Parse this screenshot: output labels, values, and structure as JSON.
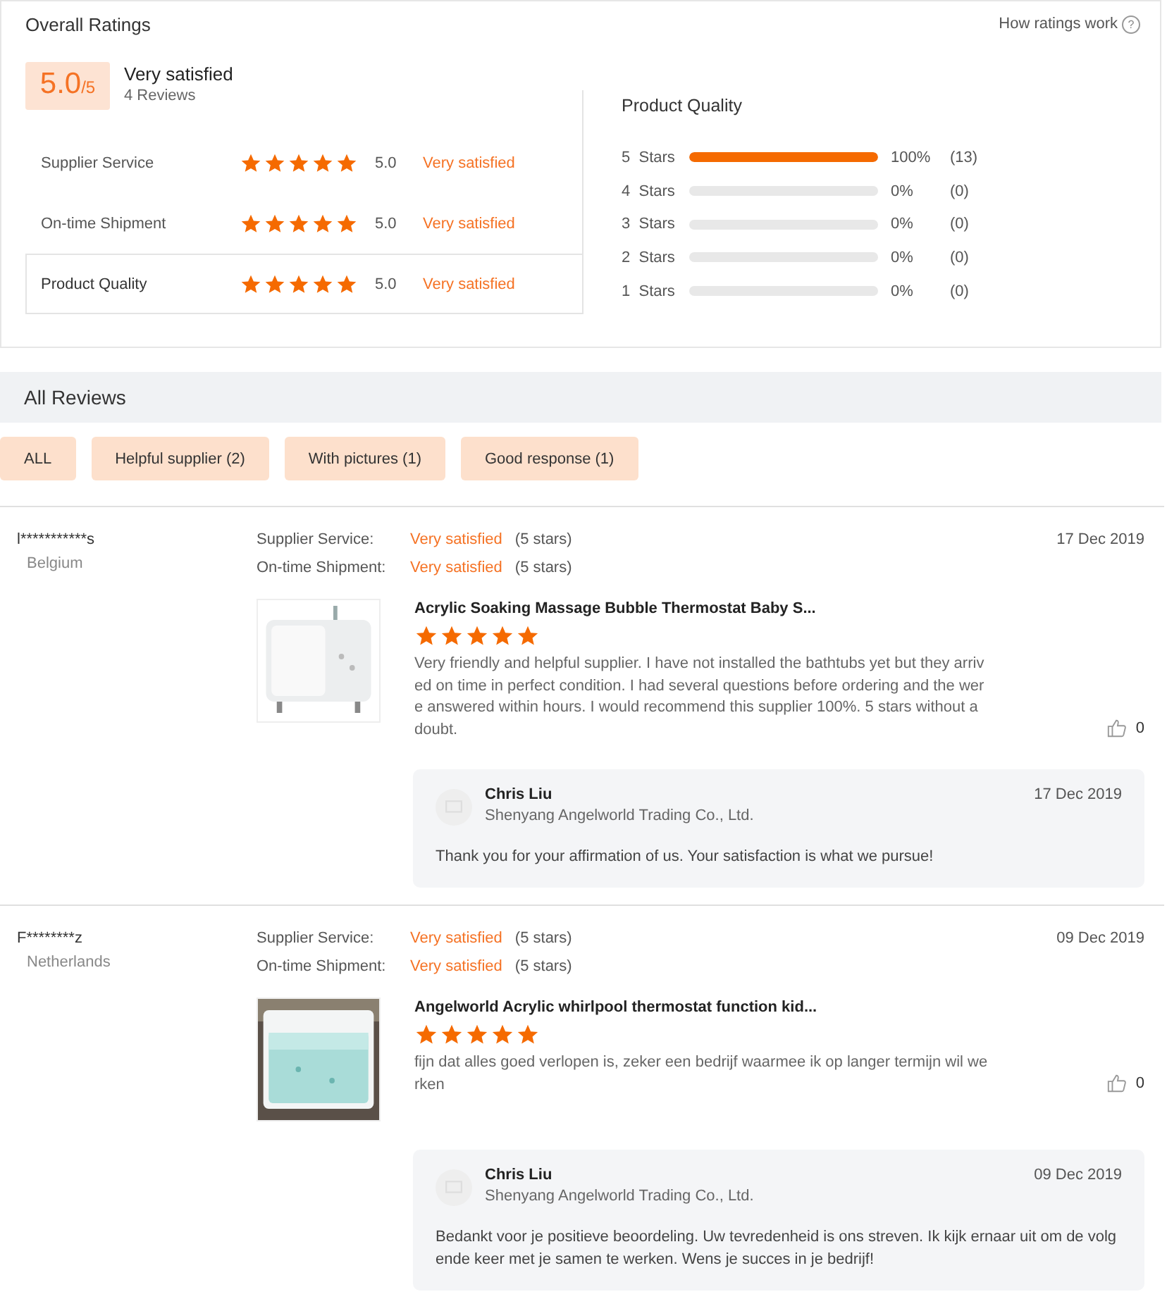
{
  "overall": {
    "title": "Overall Ratings",
    "help_link": "How ratings work",
    "help_icon": "?",
    "score": "5.0",
    "score_max": "/5",
    "verdict": "Very satisfied",
    "review_count": "4 Reviews",
    "categories": [
      {
        "name": "Supplier Service",
        "stars": 5,
        "score": "5.0",
        "verdict": "Very satisfied",
        "selected": false
      },
      {
        "name": "On-time Shipment",
        "stars": 5,
        "score": "5.0",
        "verdict": "Very satisfied",
        "selected": false
      },
      {
        "name": "Product Quality",
        "stars": 5,
        "score": "5.0",
        "verdict": "Very satisfied",
        "selected": true
      }
    ],
    "breakdown": {
      "title": "Product Quality",
      "rows": [
        {
          "label": "5  Stars",
          "level": 1,
          "percent": "100%",
          "count": "(13)"
        },
        {
          "label": "4  Stars",
          "percent": "0%",
          "count": "(0)"
        },
        {
          "label": "3  Stars",
          "percent": "0%",
          "count": "(0)"
        },
        {
          "label": "2  Stars",
          "percent": "0%",
          "count": "(0)"
        },
        {
          "label": "1  Stars",
          "percent": "0%",
          "count": "(0)"
        }
      ]
    }
  },
  "reviews_header": "All Reviews",
  "filters": [
    "ALL",
    "Helpful supplier (2)",
    "With pictures (1)",
    "Good response (1)"
  ],
  "reviews": [
    {
      "reviewer": "l***********s",
      "country": "Belgium",
      "date": "17 Dec 2019",
      "ratings": [
        {
          "label": "Supplier Service:",
          "verdict": "Very satisfied",
          "stars": "(5 stars)"
        },
        {
          "label": "On-time Shipment:",
          "verdict": "Very satisfied",
          "stars": "(5 stars)"
        }
      ],
      "product": "Acrylic Soaking Massage Bubble Thermostat Baby S...",
      "stars": 5,
      "picture": {
        "kind": "picture"
      },
      "text": "Very friendly and helpful supplier. I have not installed the bathtubs yet but they arrived on time in perfect condition. I had several questions before ordering and the were answered within hours. I would recommend this supplier 100%. 5 stars without a doubt.",
      "likes": "0",
      "reply": {
        "name": "Chris Liu",
        "company": "Shenyang Angelworld Trading Co., Ltd.",
        "date": "17 Dec 2019",
        "text": "Thank you for your affirmation of us. Your satisfaction is what we pursue!"
      }
    },
    {
      "reviewer": "F********z",
      "country": "Netherlands",
      "date": "09 Dec 2019",
      "ratings": [
        {
          "label": "Supplier Service:",
          "verdict": "Very satisfied",
          "stars": "(5 stars)"
        },
        {
          "label": "On-time Shipment:",
          "verdict": "Very satisfied",
          "stars": "(5 stars)"
        }
      ],
      "product": "Angelworld Acrylic whirlpool thermostat function kid...",
      "stars": 5,
      "picture": {
        "kind": "picture"
      },
      "text": "fijn dat alles goed verlopen is, zeker een bedrijf waarmee ik op langer termijn wil werken",
      "likes": "0",
      "reply": {
        "name": "Chris Liu",
        "company": "Shenyang Angelworld Trading Co., Ltd.",
        "date": "09 Dec 2019",
        "text": "Bedankt voor je positieve beoordeling. Uw tevredenheid is ons streven. Ik kijk ernaar uit om de volgende keer met je samen te werken. Wens je succes in je bedrijf!"
      }
    }
  ]
}
